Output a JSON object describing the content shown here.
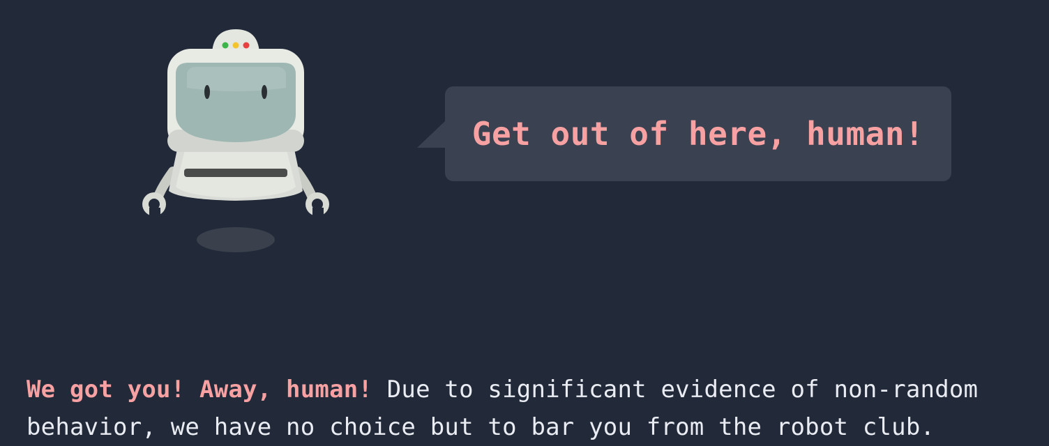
{
  "robot": {
    "icon": "robot-illustration-icon",
    "indicator_colors": [
      "#3bb54a",
      "#f4c430",
      "#e84040"
    ]
  },
  "speech_bubble": {
    "text": "Get out of here, human!"
  },
  "message": {
    "lead": "We got you! Away, human!",
    "body": " Due to significant evidence of non-random behavior, we have no choice but to bar you from the robot club."
  },
  "colors": {
    "background": "#222938",
    "bubble": "#3a4252",
    "accent": "#f7a1a3",
    "text": "#e9ecf2"
  }
}
